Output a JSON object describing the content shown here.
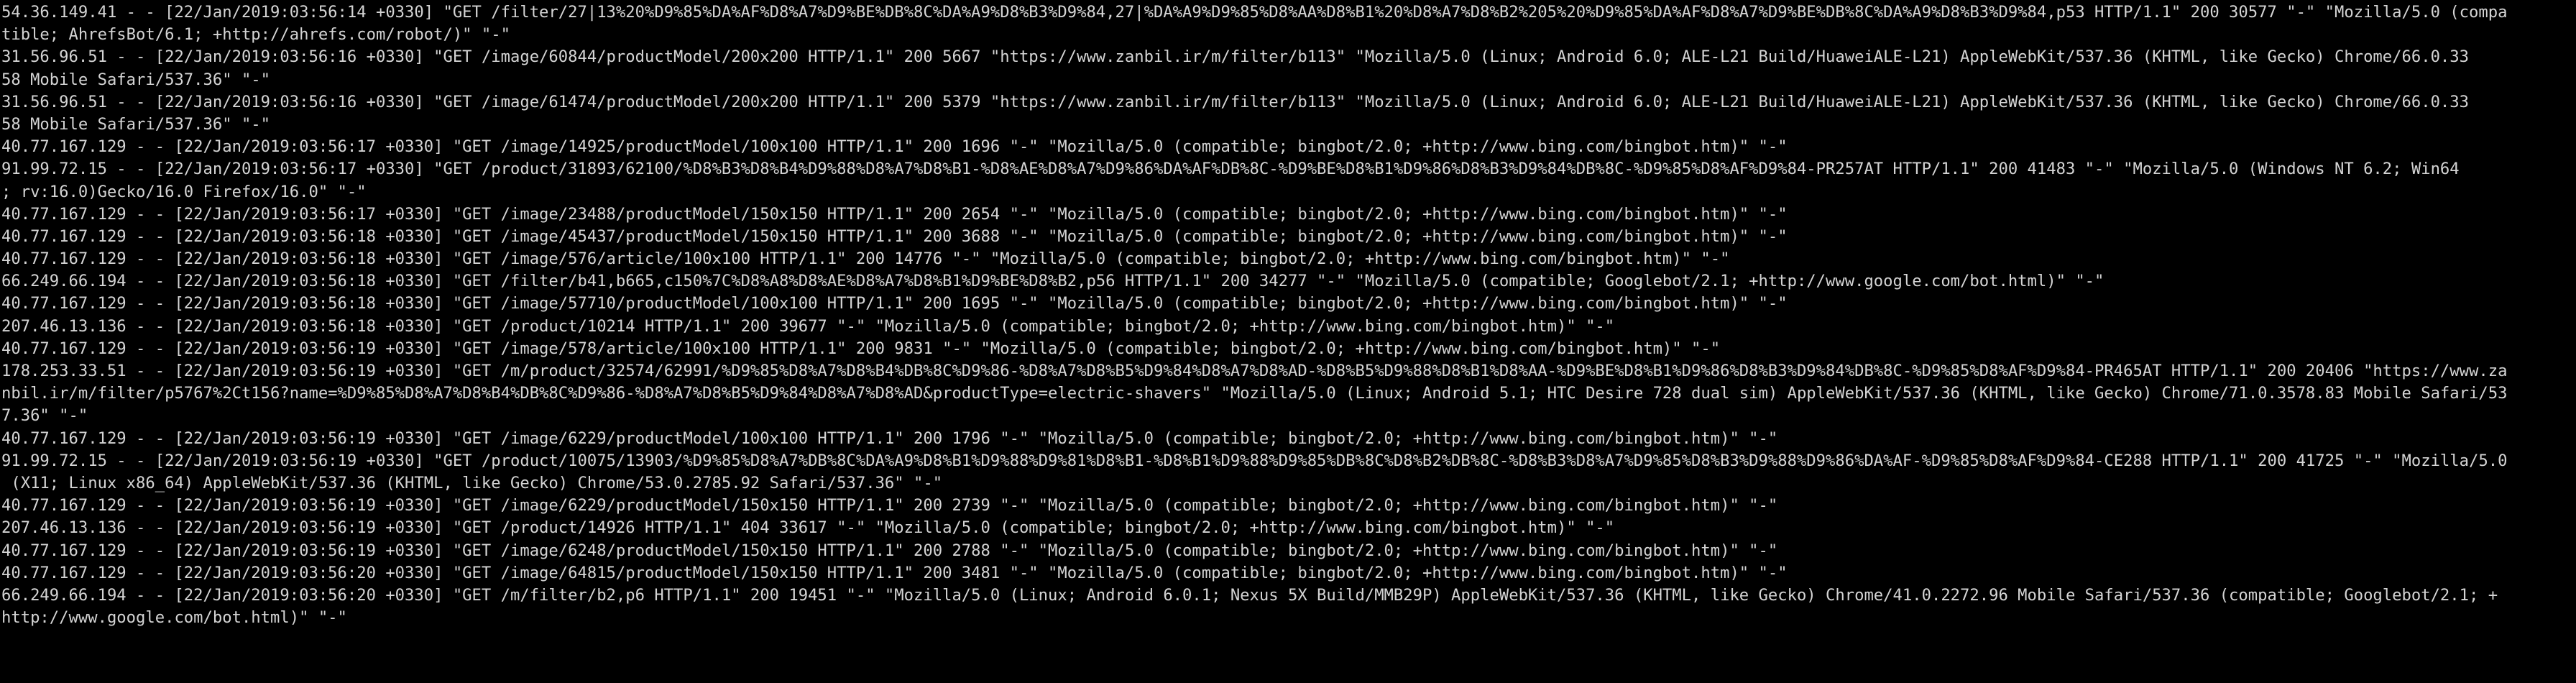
{
  "terminal": {
    "lines": [
      "54.36.149.41 - - [22/Jan/2019:03:56:14 +0330] \"GET /filter/27|13%20%D9%85%DA%AF%D8%A7%D9%BE%DB%8C%DA%A9%D8%B3%D9%84,27|%DA%A9%D9%85%D8%AA%D8%B1%20%D8%A7%D8%B2%205%20%D9%85%DA%AF%D8%A7%D9%BE%DB%8C%DA%A9%D8%B3%D9%84,p53 HTTP/1.1\" 200 30577 \"-\" \"Mozilla/5.0 (compa",
      "tible; AhrefsBot/6.1; +http://ahrefs.com/robot/)\" \"-\"",
      "31.56.96.51 - - [22/Jan/2019:03:56:16 +0330] \"GET /image/60844/productModel/200x200 HTTP/1.1\" 200 5667 \"https://www.zanbil.ir/m/filter/b113\" \"Mozilla/5.0 (Linux; Android 6.0; ALE-L21 Build/HuaweiALE-L21) AppleWebKit/537.36 (KHTML, like Gecko) Chrome/66.0.33",
      "58 Mobile Safari/537.36\" \"-\"",
      "31.56.96.51 - - [22/Jan/2019:03:56:16 +0330] \"GET /image/61474/productModel/200x200 HTTP/1.1\" 200 5379 \"https://www.zanbil.ir/m/filter/b113\" \"Mozilla/5.0 (Linux; Android 6.0; ALE-L21 Build/HuaweiALE-L21) AppleWebKit/537.36 (KHTML, like Gecko) Chrome/66.0.33",
      "58 Mobile Safari/537.36\" \"-\"",
      "40.77.167.129 - - [22/Jan/2019:03:56:17 +0330] \"GET /image/14925/productModel/100x100 HTTP/1.1\" 200 1696 \"-\" \"Mozilla/5.0 (compatible; bingbot/2.0; +http://www.bing.com/bingbot.htm)\" \"-\"",
      "91.99.72.15 - - [22/Jan/2019:03:56:17 +0330] \"GET /product/31893/62100/%D8%B3%D8%B4%D9%88%D8%A7%D8%B1-%D8%AE%D8%A7%D9%86%DA%AF%DB%8C-%D9%BE%D8%B1%D9%86%D8%B3%D9%84%DB%8C-%D9%85%D8%AF%D9%84-PR257AT HTTP/1.1\" 200 41483 \"-\" \"Mozilla/5.0 (Windows NT 6.2; Win64",
      "; rv:16.0)Gecko/16.0 Firefox/16.0\" \"-\"",
      "40.77.167.129 - - [22/Jan/2019:03:56:17 +0330] \"GET /image/23488/productModel/150x150 HTTP/1.1\" 200 2654 \"-\" \"Mozilla/5.0 (compatible; bingbot/2.0; +http://www.bing.com/bingbot.htm)\" \"-\"",
      "40.77.167.129 - - [22/Jan/2019:03:56:18 +0330] \"GET /image/45437/productModel/150x150 HTTP/1.1\" 200 3688 \"-\" \"Mozilla/5.0 (compatible; bingbot/2.0; +http://www.bing.com/bingbot.htm)\" \"-\"",
      "40.77.167.129 - - [22/Jan/2019:03:56:18 +0330] \"GET /image/576/article/100x100 HTTP/1.1\" 200 14776 \"-\" \"Mozilla/5.0 (compatible; bingbot/2.0; +http://www.bing.com/bingbot.htm)\" \"-\"",
      "66.249.66.194 - - [22/Jan/2019:03:56:18 +0330] \"GET /filter/b41,b665,c150%7C%D8%A8%D8%AE%D8%A7%D8%B1%D9%BE%D8%B2,p56 HTTP/1.1\" 200 34277 \"-\" \"Mozilla/5.0 (compatible; Googlebot/2.1; +http://www.google.com/bot.html)\" \"-\"",
      "40.77.167.129 - - [22/Jan/2019:03:56:18 +0330] \"GET /image/57710/productModel/100x100 HTTP/1.1\" 200 1695 \"-\" \"Mozilla/5.0 (compatible; bingbot/2.0; +http://www.bing.com/bingbot.htm)\" \"-\"",
      "207.46.13.136 - - [22/Jan/2019:03:56:18 +0330] \"GET /product/10214 HTTP/1.1\" 200 39677 \"-\" \"Mozilla/5.0 (compatible; bingbot/2.0; +http://www.bing.com/bingbot.htm)\" \"-\"",
      "40.77.167.129 - - [22/Jan/2019:03:56:19 +0330] \"GET /image/578/article/100x100 HTTP/1.1\" 200 9831 \"-\" \"Mozilla/5.0 (compatible; bingbot/2.0; +http://www.bing.com/bingbot.htm)\" \"-\"",
      "178.253.33.51 - - [22/Jan/2019:03:56:19 +0330] \"GET /m/product/32574/62991/%D9%85%D8%A7%D8%B4%DB%8C%D9%86-%D8%A7%D8%B5%D9%84%D8%A7%D8%AD-%D8%B5%D9%88%D8%B1%D8%AA-%D9%BE%D8%B1%D9%86%D8%B3%D9%84%DB%8C-%D9%85%D8%AF%D9%84-PR465AT HTTP/1.1\" 200 20406 \"https://www.za",
      "nbil.ir/m/filter/p5767%2Ct156?name=%D9%85%D8%A7%D8%B4%DB%8C%D9%86-%D8%A7%D8%B5%D9%84%D8%A7%D8%AD&productType=electric-shavers\" \"Mozilla/5.0 (Linux; Android 5.1; HTC Desire 728 dual sim) AppleWebKit/537.36 (KHTML, like Gecko) Chrome/71.0.3578.83 Mobile Safari/53",
      "7.36\" \"-\"",
      "40.77.167.129 - - [22/Jan/2019:03:56:19 +0330] \"GET /image/6229/productModel/100x100 HTTP/1.1\" 200 1796 \"-\" \"Mozilla/5.0 (compatible; bingbot/2.0; +http://www.bing.com/bingbot.htm)\" \"-\"",
      "91.99.72.15 - - [22/Jan/2019:03:56:19 +0330] \"GET /product/10075/13903/%D9%85%D8%A7%DB%8C%DA%A9%D8%B1%D9%88%D9%81%D8%B1-%D8%B1%D9%88%D9%85%DB%8C%D8%B2%DB%8C-%D8%B3%D8%A7%D9%85%D8%B3%D9%88%D9%86%DA%AF-%D9%85%D8%AF%D9%84-CE288 HTTP/1.1\" 200 41725 \"-\" \"Mozilla/5.0",
      " (X11; Linux x86_64) AppleWebKit/537.36 (KHTML, like Gecko) Chrome/53.0.2785.92 Safari/537.36\" \"-\"",
      "40.77.167.129 - - [22/Jan/2019:03:56:19 +0330] \"GET /image/6229/productModel/150x150 HTTP/1.1\" 200 2739 \"-\" \"Mozilla/5.0 (compatible; bingbot/2.0; +http://www.bing.com/bingbot.htm)\" \"-\"",
      "207.46.13.136 - - [22/Jan/2019:03:56:19 +0330] \"GET /product/14926 HTTP/1.1\" 404 33617 \"-\" \"Mozilla/5.0 (compatible; bingbot/2.0; +http://www.bing.com/bingbot.htm)\" \"-\"",
      "40.77.167.129 - - [22/Jan/2019:03:56:19 +0330] \"GET /image/6248/productModel/150x150 HTTP/1.1\" 200 2788 \"-\" \"Mozilla/5.0 (compatible; bingbot/2.0; +http://www.bing.com/bingbot.htm)\" \"-\"",
      "40.77.167.129 - - [22/Jan/2019:03:56:20 +0330] \"GET /image/64815/productModel/150x150 HTTP/1.1\" 200 3481 \"-\" \"Mozilla/5.0 (compatible; bingbot/2.0; +http://www.bing.com/bingbot.htm)\" \"-\"",
      "66.249.66.194 - - [22/Jan/2019:03:56:20 +0330] \"GET /m/filter/b2,p6 HTTP/1.1\" 200 19451 \"-\" \"Mozilla/5.0 (Linux; Android 6.0.1; Nexus 5X Build/MMB29P) AppleWebKit/537.36 (KHTML, like Gecko) Chrome/41.0.2272.96 Mobile Safari/537.36 (compatible; Googlebot/2.1; +",
      "http://www.google.com/bot.html)\" \"-\""
    ]
  }
}
